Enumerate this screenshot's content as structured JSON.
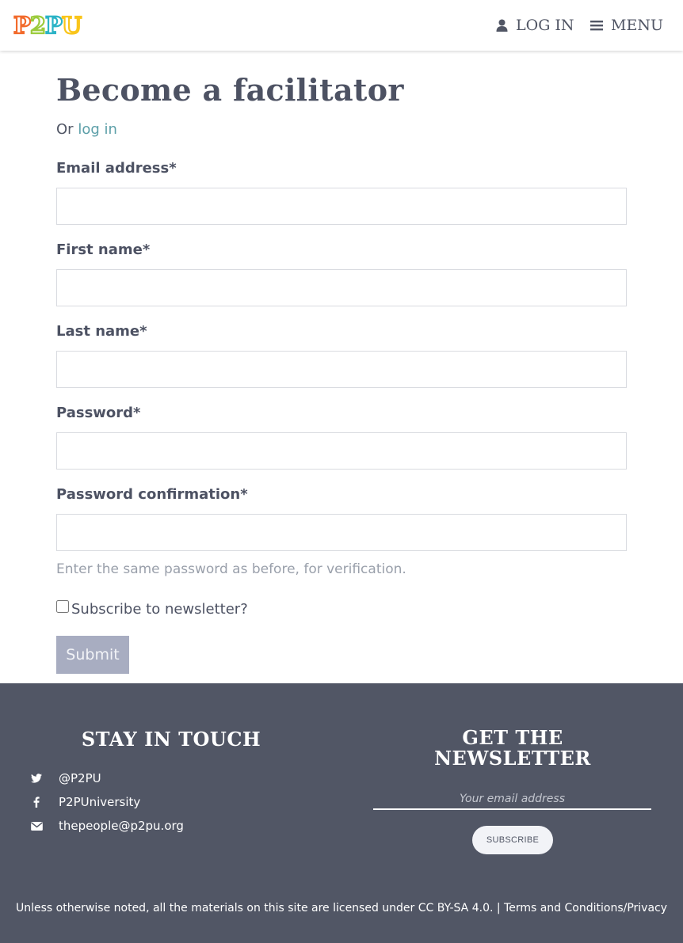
{
  "header": {
    "logo_letters": [
      "P",
      "2",
      "P",
      "U"
    ],
    "login_label": "LOG IN",
    "menu_label": "MENU"
  },
  "main": {
    "title": "Become a facilitator",
    "or_text": "Or",
    "login_link": "log in",
    "fields": {
      "email": {
        "label": "Email address*",
        "value": ""
      },
      "first_name": {
        "label": "First name*",
        "value": ""
      },
      "last_name": {
        "label": "Last name*",
        "value": ""
      },
      "password": {
        "label": "Password*",
        "value": ""
      },
      "password_confirm": {
        "label": "Password confirmation*",
        "value": ""
      }
    },
    "password_help": "Enter the same password as before, for verification.",
    "newsletter_label": "Subscribe to newsletter?",
    "submit_label": "Submit"
  },
  "footer": {
    "stay_heading": "STAY IN TOUCH",
    "social": {
      "twitter": "@P2PU",
      "facebook": "P2PUniversity",
      "email": "thepeople@p2pu.org"
    },
    "newsletter_heading_line1": "GET THE",
    "newsletter_heading_line2": "NEWSLETTER",
    "email_placeholder": "Your email address",
    "subscribe_label": "SUBSCRIBE",
    "license_text": "Unless otherwise noted, all the materials on this site are licensed under CC BY-SA 4.0. | Terms and Conditions/Privacy"
  },
  "colors": {
    "text": "#515665",
    "link": "#5c9fa8",
    "footer_bg": "#515665",
    "submit_bg": "#a8adc1",
    "logo": [
      "#f26a2b",
      "#9bcb3c",
      "#2bb3c6",
      "#f9c51a"
    ]
  },
  "icons": {
    "login": "user-icon",
    "menu": "hamburger-icon",
    "twitter": "twitter-icon",
    "facebook": "facebook-icon",
    "email": "envelope-icon"
  }
}
